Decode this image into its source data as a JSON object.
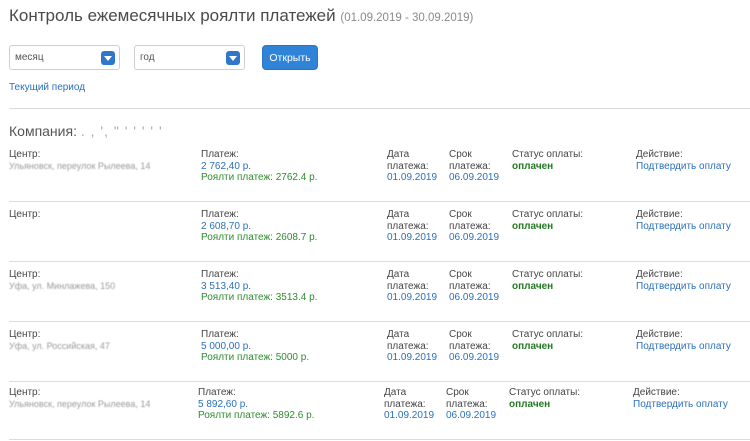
{
  "header": {
    "title": "Контроль ежемесячных роялти платежей",
    "period_range": "(01.09.2019 - 30.09.2019)"
  },
  "filters": {
    "month_value": "месяц",
    "year_value": "год",
    "open_label": "Открыть",
    "current_period_label": "Текущий период"
  },
  "company": {
    "label": "Компания:",
    "name": ". , ', \" ' ' ' ' '"
  },
  "colors": {
    "accent": "#2f84d8",
    "link": "#2b70b9",
    "paid": "#237a23",
    "royalty": "#2e8b2e"
  },
  "labels": {
    "center": "Центр:",
    "payment": "Платеж:",
    "payment_date_l1": "Дата",
    "payment_date_l2": "платежа:",
    "due_date_l1": "Срок",
    "due_date_l2": "платежа:",
    "status": "Статус оплаты:",
    "action": "Действие:"
  },
  "rows": [
    {
      "center": "Ульяновск, переулок Рылеева, 14",
      "payment": "2 762,40 р.",
      "royalty": "Роялти платеж: 2762.4 р.",
      "payment_date": "01.09.2019",
      "due_date": "06.09.2019",
      "status": "оплачен",
      "action": "Подтвердить оплату"
    },
    {
      "center": "",
      "payment": "2 608,70 р.",
      "royalty": "Роялти платеж: 2608.7 р.",
      "payment_date": "01.09.2019",
      "due_date": "06.09.2019",
      "status": "оплачен",
      "action": "Подтвердить оплату"
    },
    {
      "center": "Уфа, ул. Минлажева, 150",
      "payment": "3 513,40 р.",
      "royalty": "Роялти платеж: 3513.4 р.",
      "payment_date": "01.09.2019",
      "due_date": "06.09.2019",
      "status": "оплачен",
      "action": "Подтвердить оплату"
    },
    {
      "center": "Уфа, ул. Российская, 47",
      "payment": "5 000,00 р.",
      "royalty": "Роялти платеж: 5000 р.",
      "payment_date": "01.09.2019",
      "due_date": "06.09.2019",
      "status": "оплачен",
      "action": "Подтвердить оплату"
    },
    {
      "center": "Ульяновск, переулок Рылеева, 14",
      "payment": "5 892,60 р.",
      "royalty": "Роялти платеж: 5892.6 р.",
      "payment_date": "01.09.2019",
      "due_date": "06.09.2019",
      "status": "оплачен",
      "action": "Подтвердить оплату"
    }
  ]
}
